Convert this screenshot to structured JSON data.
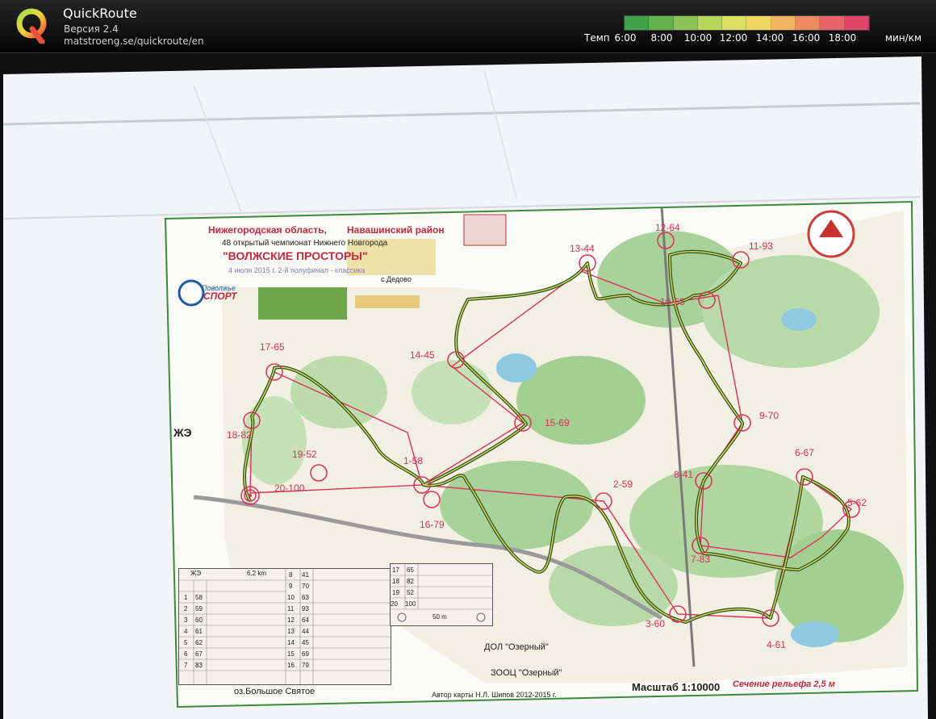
{
  "app": {
    "name": "QuickRoute",
    "version": "Версия 2.4",
    "url": "matstroeng.se/quickroute/en"
  },
  "pace_scale": {
    "label": "Темп",
    "ticks": [
      "6:00",
      "8:00",
      "10:00",
      "12:00",
      "14:00",
      "16:00",
      "18:00"
    ],
    "unit": "мин/км",
    "colors": [
      "#3fa14a",
      "#62b24f",
      "#8cc456",
      "#b6d65c",
      "#dade63",
      "#efd663",
      "#f3b562",
      "#ee8a60",
      "#e8626a",
      "#e04466"
    ]
  },
  "map": {
    "region": "Нижегородская область,",
    "district": "Навашинский район",
    "event": "48 открытый чемпионат Нижнего Новгорода",
    "title": "\"ВОЛЖСКИЕ ПРОСТОРЫ\"",
    "date": "4 июля 2015 г.  2-й полуфинал - классика",
    "village": "с.Дедово",
    "sponsor_top": "Поволжье",
    "sponsor_bottom": "СПОРТ",
    "group": "ЖЭ",
    "scale": "Масштаб 1:10000",
    "contour": "Сечение рельефа 2,5 м",
    "author": "Автор карты   Н.Л. Шипов   2012-2015 г.",
    "lake": "оз.Большое Святое",
    "camp1": "ДОЛ \"Озерный\"",
    "camp2": "ЗООЦ \"Озерный\"",
    "controls": [
      {
        "label": "1-58"
      },
      {
        "label": "2-59"
      },
      {
        "label": "3-60"
      },
      {
        "label": "4-61"
      },
      {
        "label": "5-62"
      },
      {
        "label": "6-67"
      },
      {
        "label": "7-83"
      },
      {
        "label": "8-41"
      },
      {
        "label": "9-70"
      },
      {
        "label": "10-63"
      },
      {
        "label": "11-93"
      },
      {
        "label": "12-64"
      },
      {
        "label": "13-44"
      },
      {
        "label": "14-45"
      },
      {
        "label": "15-69"
      },
      {
        "label": "16-79"
      },
      {
        "label": "17-65"
      },
      {
        "label": "18-82"
      },
      {
        "label": "19-52"
      },
      {
        "label": "20-100"
      }
    ],
    "desc_table": {
      "header_group": "ЖЭ",
      "header_distance": "6,2 km",
      "rows_left": [
        [
          "1",
          "58"
        ],
        [
          "2",
          "59"
        ],
        [
          "3",
          "60"
        ],
        [
          "4",
          "61"
        ],
        [
          "5",
          "62"
        ],
        [
          "6",
          "67"
        ],
        [
          "7",
          "83"
        ]
      ],
      "rows_mid": [
        [
          "8",
          "41"
        ],
        [
          "9",
          "70"
        ],
        [
          "10",
          "63"
        ],
        [
          "11",
          "93"
        ],
        [
          "12",
          "64"
        ],
        [
          "13",
          "44"
        ],
        [
          "14",
          "45"
        ],
        [
          "15",
          "69"
        ],
        [
          "16",
          "79"
        ]
      ],
      "rows_right": [
        [
          "17",
          "65"
        ],
        [
          "18",
          "82"
        ],
        [
          "19",
          "52"
        ],
        [
          "20",
          "100"
        ]
      ],
      "finish_dist": "50 m"
    }
  }
}
